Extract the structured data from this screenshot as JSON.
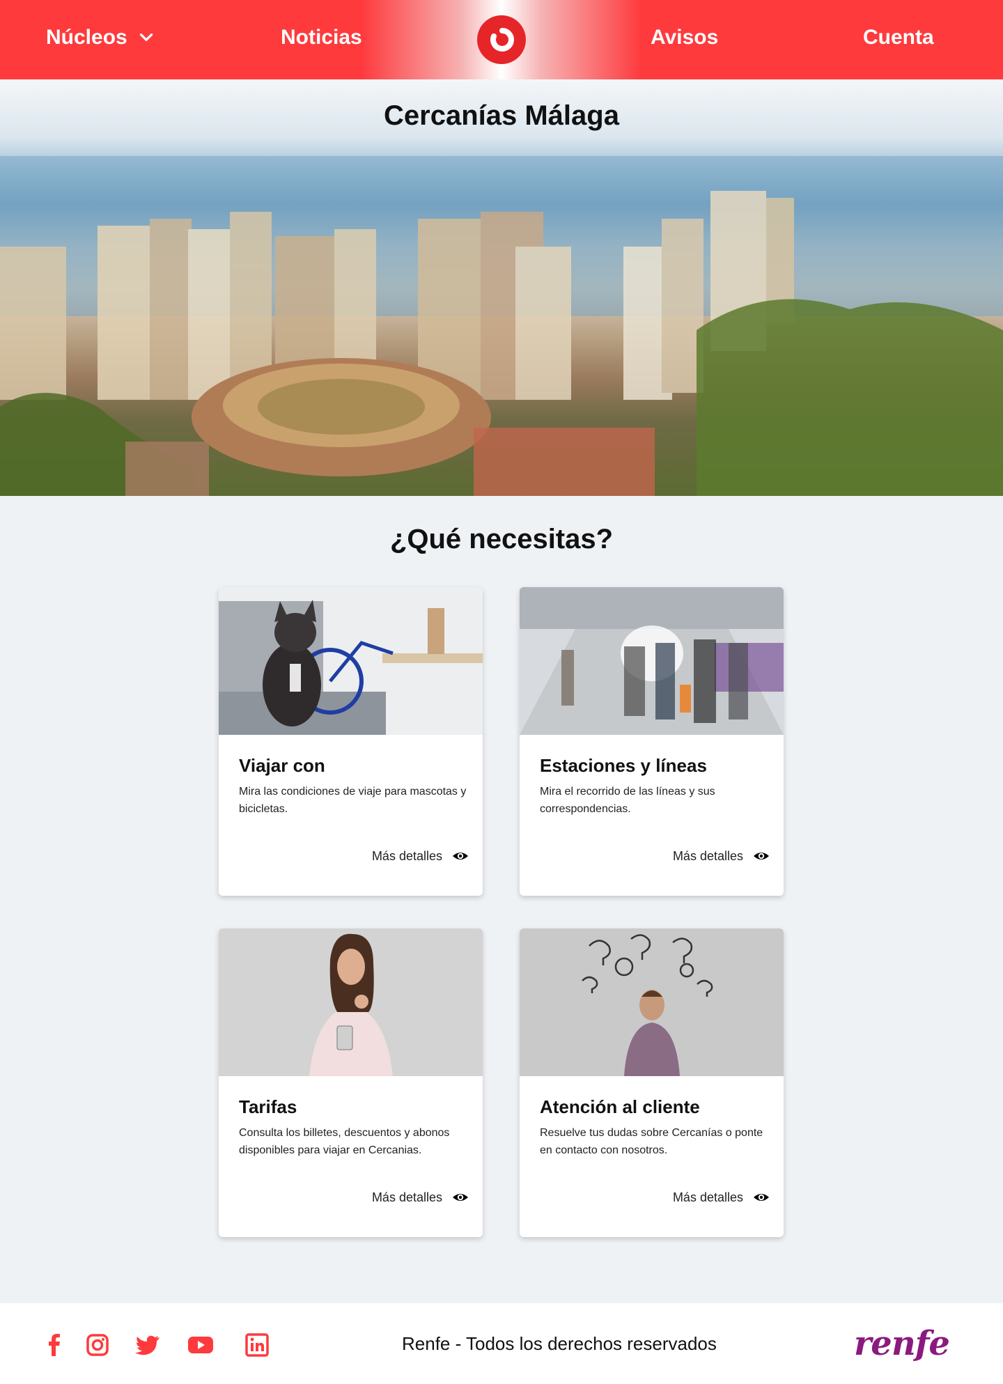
{
  "header": {
    "nav": [
      {
        "label": "Núcleos"
      },
      {
        "label": "Noticias"
      },
      {
        "label": "Avisos"
      },
      {
        "label": "Cuenta"
      }
    ]
  },
  "hero": {
    "title": "Cercanías Málaga"
  },
  "main": {
    "heading": "¿Qué necesitas?",
    "cards": [
      {
        "title": "Viajar con",
        "description": "Mira las condiciones de viaje para mascotas y bicicletas.",
        "link": "Más detalles"
      },
      {
        "title": "Estaciones y líneas",
        "description": "Mira el recorrido de las líneas y sus correspondencias.",
        "link": "Más detalles"
      },
      {
        "title": "Tarifas",
        "description": "Consulta los billetes, descuentos y abonos disponibles para viajar en Cercanias.",
        "link": "Más detalles"
      },
      {
        "title": "Atención al cliente",
        "description": "Resuelve tus dudas sobre Cercanías o ponte en contacto con nosotros.",
        "link": "Más detalles"
      }
    ]
  },
  "footer": {
    "social_icons": [
      "facebook-icon",
      "instagram-icon",
      "twitter-icon",
      "youtube-icon",
      "linkedin-icon"
    ],
    "copyright": "Renfe - Todos los derechos reservados",
    "brand": "renfe"
  },
  "colors": {
    "accent": "#fe3a3d",
    "brand_purple": "#8a1a7e",
    "background": "#eff2f5"
  }
}
